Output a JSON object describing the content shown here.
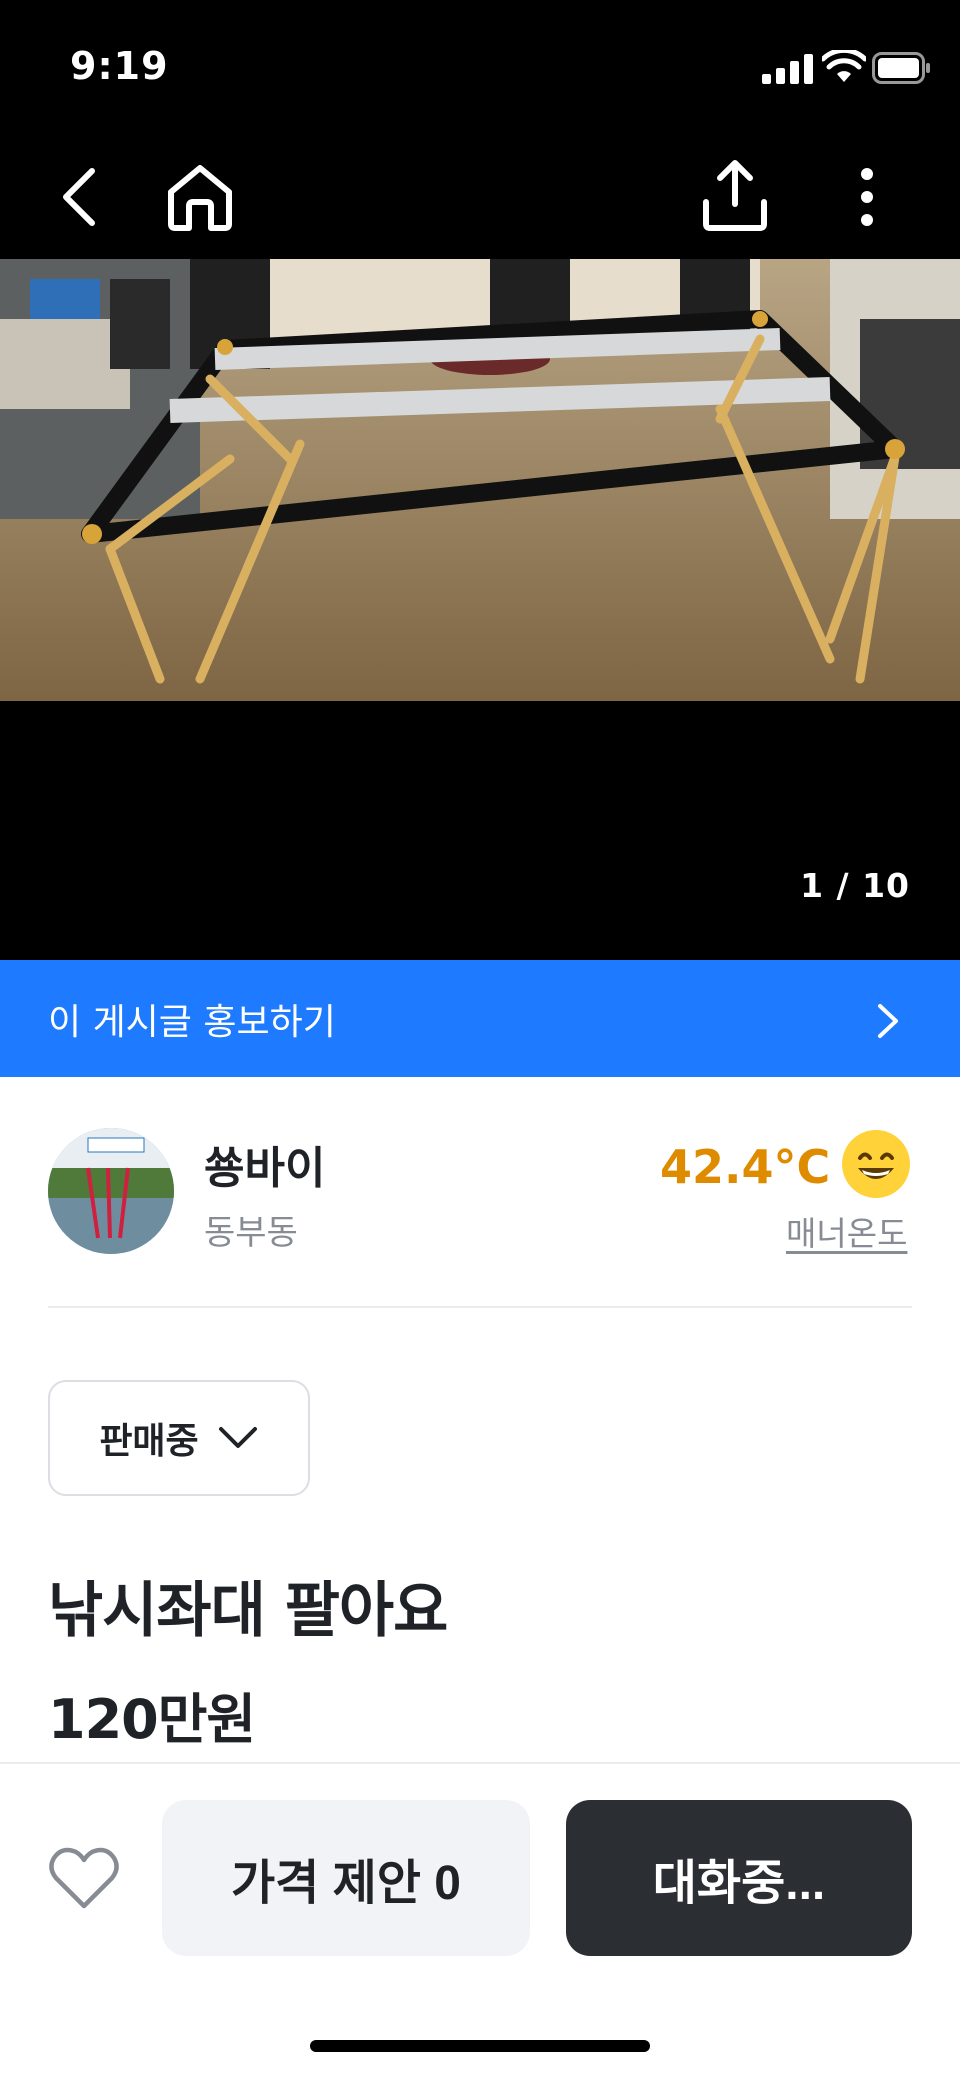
{
  "status_bar": {
    "time": "9:19"
  },
  "photo": {
    "counter": "1 / 10"
  },
  "promote": {
    "label": "이 게시글 홍보하기"
  },
  "seller": {
    "name": "쑝바이",
    "location": "동부동",
    "temperature": "42.4°C",
    "manner_label": "매너온도"
  },
  "item": {
    "status": "판매중",
    "title": "낚시좌대 팔아요",
    "price": "120만원"
  },
  "actions": {
    "offer_label": "가격 제안 0",
    "chat_label": "대화중..."
  },
  "colors": {
    "accent_blue": "#1e7bff",
    "temperature_orange": "#df8b00",
    "dark_button": "#2b2e33"
  },
  "icons": [
    "back-icon",
    "home-icon",
    "share-icon",
    "more-icon",
    "chevron-right-icon",
    "chevron-down-icon",
    "heart-icon",
    "smile-emoji-icon"
  ]
}
